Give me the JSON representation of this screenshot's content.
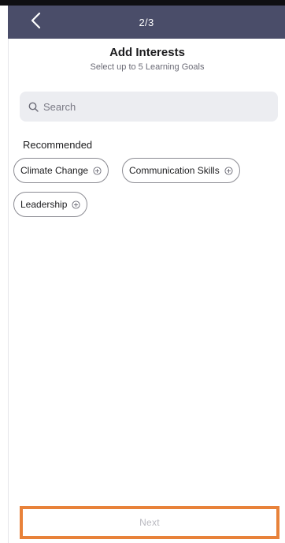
{
  "header": {
    "step": "2/3",
    "back_icon": "chevron-left-icon",
    "bg_color": "#4a4d69"
  },
  "page": {
    "title": "Add Interests",
    "subtitle": "Select up to 5 Learning Goals"
  },
  "search": {
    "placeholder": "Search",
    "value": "",
    "icon": "search-icon"
  },
  "recommended": {
    "label": "Recommended",
    "chips": [
      {
        "label": "Climate Change"
      },
      {
        "label": "Communication Skills"
      },
      {
        "label": "Leadership"
      }
    ],
    "chip_icon": "plus-circle-icon"
  },
  "footer": {
    "next_label": "Next",
    "highlight_color": "#e8823a"
  }
}
